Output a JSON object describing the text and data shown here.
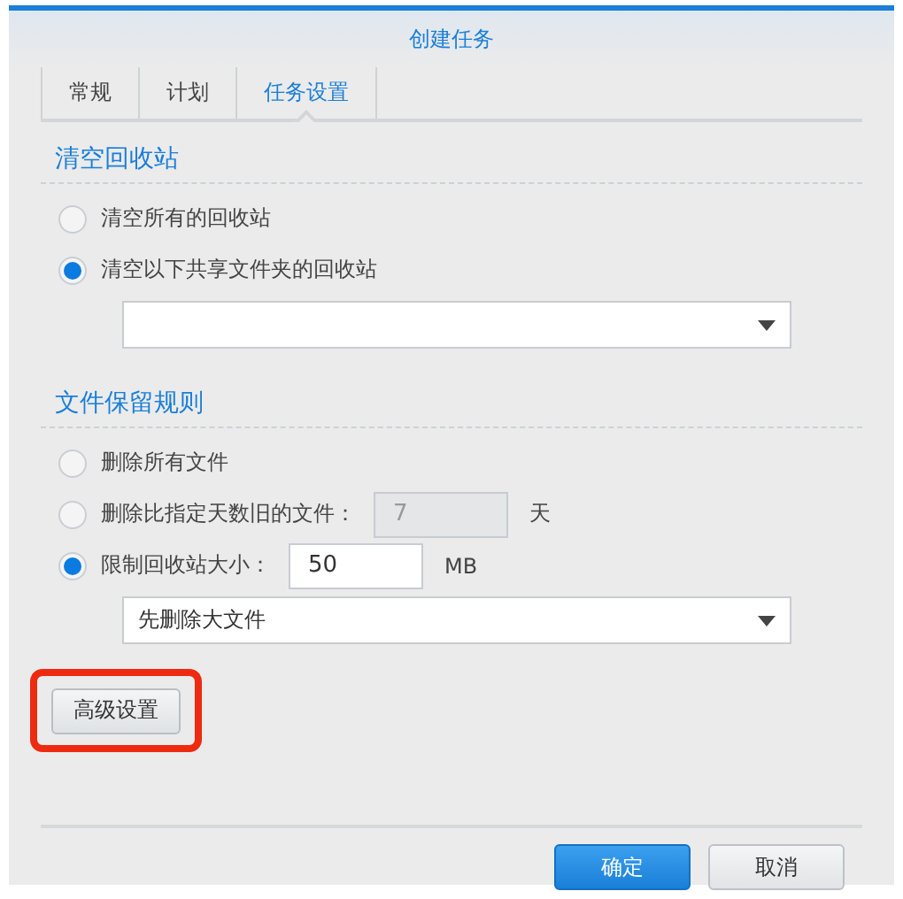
{
  "window": {
    "title": "创建任务"
  },
  "tabs": [
    {
      "label": "常规",
      "selected": false
    },
    {
      "label": "计划",
      "selected": false
    },
    {
      "label": "任务设置",
      "selected": true
    }
  ],
  "sections": [
    {
      "title": "清空回收站",
      "options": [
        {
          "kind": "radio",
          "label": "清空所有的回收站",
          "selected": false
        },
        {
          "kind": "radio",
          "label": "清空以下共享文件夹的回收站",
          "selected": true
        },
        {
          "kind": "dropdown"
        }
      ]
    },
    {
      "title": "文件保留规则",
      "options": [
        {
          "kind": "radio",
          "label": "删除所有文件",
          "selected": false
        },
        {
          "kind": "radio",
          "label": "删除比指定天数旧的文件：",
          "selected": false,
          "field": {
            "value": "7",
            "disabled": true
          },
          "unit": "天"
        },
        {
          "kind": "radio",
          "label": "限制回收站大小：",
          "selected": true,
          "field": {
            "value": "50",
            "disabled": false
          },
          "unit": "MB"
        },
        {
          "kind": "dropdown",
          "value": "先删除大文件"
        }
      ]
    }
  ],
  "advanced_button": {
    "label": "高级设置",
    "highlighted": true
  },
  "buttons": [
    {
      "label": "确定",
      "kind": "primary"
    },
    {
      "label": "取消",
      "kind": "secondary"
    }
  ]
}
